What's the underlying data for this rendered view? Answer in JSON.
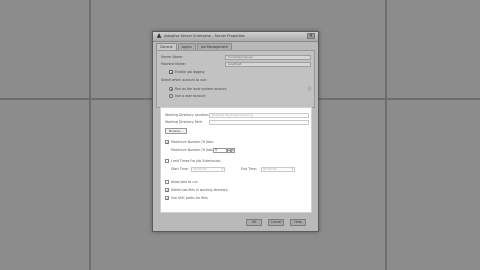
{
  "dialog": {
    "title": "Adaptive Server Enterprise - Server Properties",
    "close_glyph": "×",
    "tabs": [
      "General",
      "Logins",
      "Job Management"
    ]
  },
  "general": {
    "server_name_label": "Server Name:",
    "server_name_value": "Unnamed server",
    "machine_name_label": "Machine Name:",
    "machine_name_value": "localhost",
    "option_enable_logging": "Enable job logging",
    "section_label": "Select which account to use:",
    "radio_local": "Run as the local system account",
    "radio_user": "Use a user account"
  },
  "options": {
    "working_dir_label": "Working Directory Location:",
    "working_dir_placeholder": "(Default Working Directory)",
    "working_dir_path_label": "Working Directory Path:",
    "browse_label": "Browse...",
    "max_jobs_label": "Maximum Number Of Jobs:",
    "max_jobs_value": "5",
    "limit_times_label": "Limit Times For Job Submission",
    "start_time_label": "Start Time:",
    "start_time_value": "00:00:00",
    "end_time_label": "End Time:",
    "end_time_value": "00:00:00",
    "opt_run_on_mac": "Allow jobs to run",
    "opt_delete_files": "Delete job files in working directory",
    "opt_use_unc": "Use UNC paths for files"
  },
  "footer": {
    "ok": "OK",
    "cancel": "Cancel",
    "help": "Help"
  },
  "colors": {
    "background": "#8c8c8c",
    "panel": "#ffffff",
    "dialog": "#b9b9b9"
  },
  "icons": [
    "app-logo-icon",
    "close-icon",
    "info-icon",
    "spin-up-icon",
    "spin-down-icon",
    "chevron-down-icon"
  ]
}
